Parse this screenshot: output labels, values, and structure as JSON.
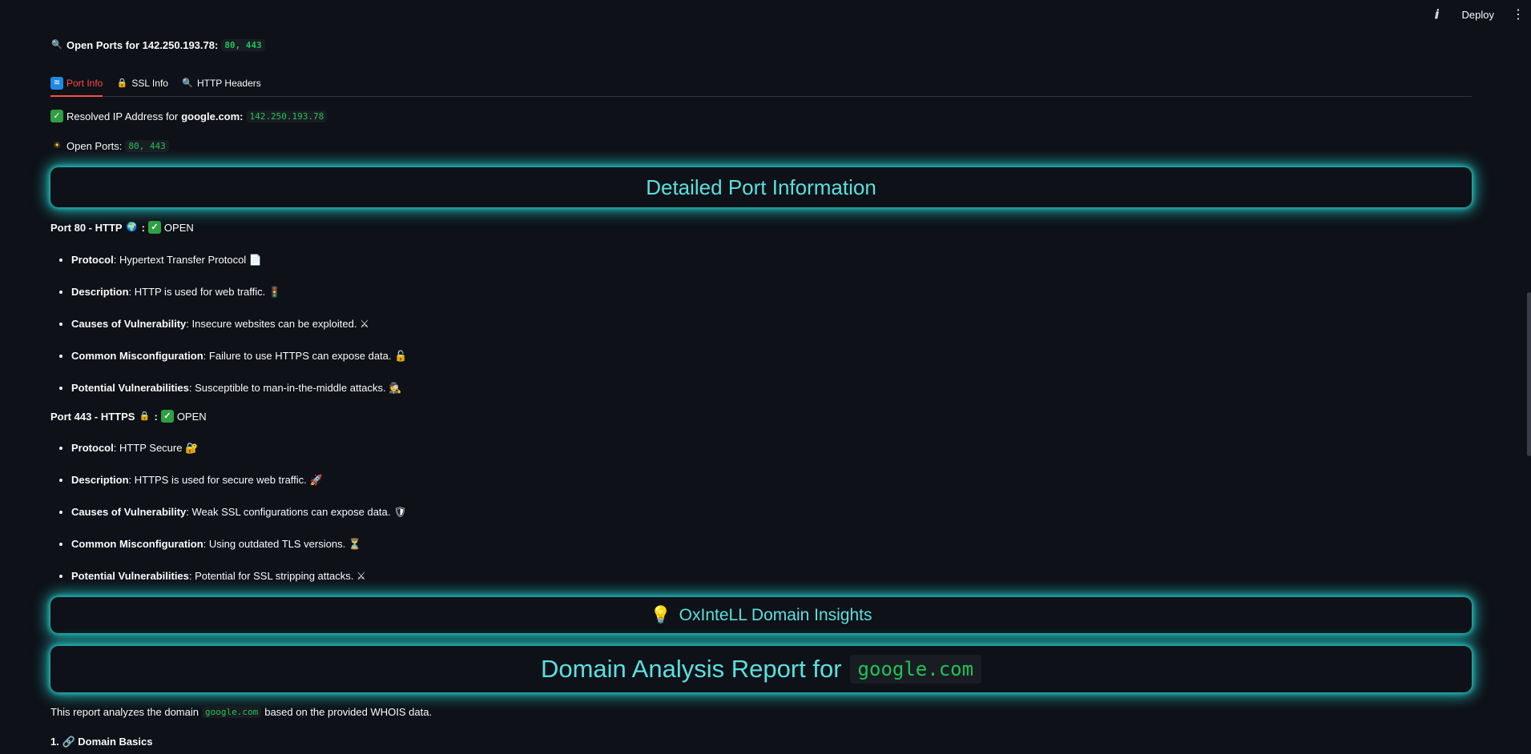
{
  "topbar": {
    "deploy_label": "Deploy"
  },
  "header": {
    "prefix": "Open Ports for 142.250.193.78:",
    "ports_code": "80, 443"
  },
  "tabs": [
    {
      "label": "Port Info",
      "icon": "wifi-icon",
      "active": true
    },
    {
      "label": "SSL Info",
      "icon": "lock-icon",
      "active": false
    },
    {
      "label": "HTTP Headers",
      "icon": "search-icon",
      "active": false
    }
  ],
  "resolved": {
    "label": "Resolved IP Address for",
    "domain": "google.com:",
    "ip": "142.250.193.78"
  },
  "open_ports": {
    "label": "Open Ports:",
    "value": "80, 443"
  },
  "section_title": "Detailed Port Information",
  "ports": [
    {
      "title": "Port 80 - HTTP",
      "status": "OPEN",
      "items": [
        {
          "key": "Protocol",
          "text": ": Hypertext Transfer Protocol",
          "icon": "📄"
        },
        {
          "key": "Description",
          "text": ": HTTP is used for web traffic.",
          "icon": "🚦"
        },
        {
          "key": "Causes of Vulnerability",
          "text": ": Insecure websites can be exploited.",
          "icon": "⚔"
        },
        {
          "key": "Common Misconfiguration",
          "text": ": Failure to use HTTPS can expose data.",
          "icon": "🔓"
        },
        {
          "key": "Potential Vulnerabilities",
          "text": ": Susceptible to man-in-the-middle attacks.",
          "icon": "🕵"
        }
      ]
    },
    {
      "title": "Port 443 - HTTPS",
      "status": "OPEN",
      "items": [
        {
          "key": "Protocol",
          "text": ": HTTP Secure",
          "icon": "🔐"
        },
        {
          "key": "Description",
          "text": ": HTTPS is used for secure web traffic.",
          "icon": "🚀"
        },
        {
          "key": "Causes of Vulnerability",
          "text": ": Weak SSL configurations can expose data.",
          "icon": "🛡"
        },
        {
          "key": "Common Misconfiguration",
          "text": ": Using outdated TLS versions.",
          "icon": "⏳"
        },
        {
          "key": "Potential Vulnerabilities",
          "text": ": Potential for SSL stripping attacks.",
          "icon": "⚔"
        }
      ]
    }
  ],
  "insights_title": "OxInteLL Domain Insights",
  "report": {
    "title": "Domain Analysis Report for",
    "domain": "google.com"
  },
  "report_intro": {
    "before": "This report analyzes the domain",
    "domain": "google.com",
    "after": "based on the provided WHOIS data."
  },
  "section1": "1. 🔗 Domain Basics"
}
